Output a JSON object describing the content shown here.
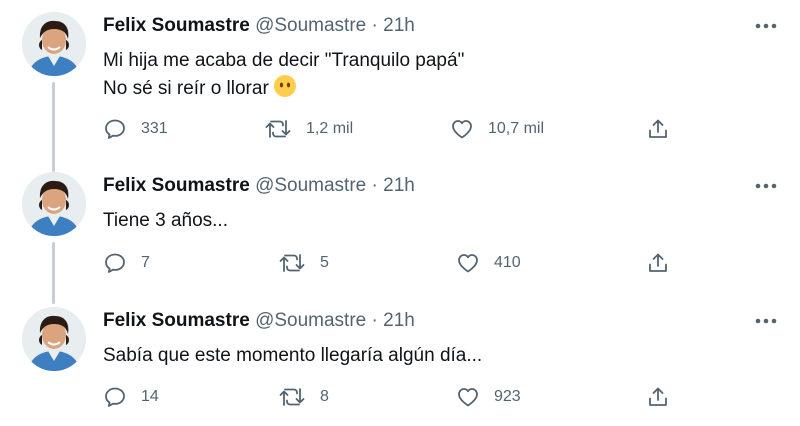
{
  "tweets": [
    {
      "name": "Felix Soumastre",
      "handle": "@Soumastre",
      "separator": "·",
      "time": "21h",
      "text_lines": [
        "Mi hija me acaba de decir \"Tranquilo papá\"",
        "No sé si reír o llorar"
      ],
      "emoji": "neutral-face-emoji",
      "replies": "331",
      "retweets": "1,2 mil",
      "likes": "10,7 mil"
    },
    {
      "name": "Felix Soumastre",
      "handle": "@Soumastre",
      "separator": "·",
      "time": "21h",
      "text_lines": [
        "Tiene 3 años..."
      ],
      "replies": "7",
      "retweets": "5",
      "likes": "410"
    },
    {
      "name": "Felix Soumastre",
      "handle": "@Soumastre",
      "separator": "·",
      "time": "21h",
      "text_lines": [
        "Sabía que este momento llegaría algún día..."
      ],
      "replies": "14",
      "retweets": "8",
      "likes": "923"
    }
  ],
  "icons": {
    "reply": "reply-icon",
    "retweet": "retweet-icon",
    "like": "heart-icon",
    "share": "share-icon",
    "more": "more-options-icon"
  },
  "colors": {
    "text": "#0f1419",
    "secondary": "#536471",
    "thread_line": "#c4cfd6"
  }
}
